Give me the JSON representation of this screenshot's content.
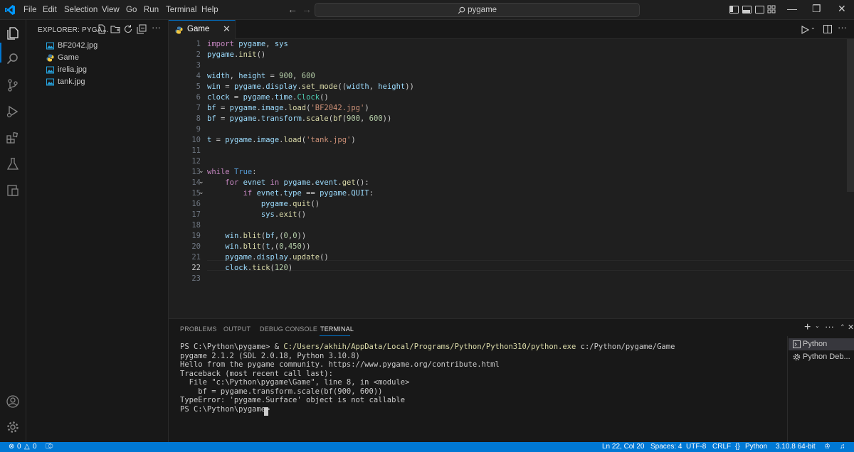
{
  "titlebar": {
    "menus": [
      "File",
      "Edit",
      "Selection",
      "View",
      "Go",
      "Run",
      "Terminal",
      "Help"
    ],
    "search": "pygame"
  },
  "sidebar": {
    "title": "EXPLORER: PYGA...",
    "files": [
      {
        "name": "BF2042.jpg",
        "icon": "image-file-icon"
      },
      {
        "name": "Game",
        "icon": "python-file-icon"
      },
      {
        "name": "irelia.jpg",
        "icon": "image-file-icon"
      },
      {
        "name": "tank.jpg",
        "icon": "image-file-icon"
      }
    ]
  },
  "editor": {
    "tab": "Game",
    "line_numbers": [
      "1",
      "2",
      "3",
      "4",
      "5",
      "6",
      "7",
      "8",
      "9",
      "10",
      "11",
      "12",
      "13",
      "14",
      "15",
      "16",
      "17",
      "18",
      "19",
      "20",
      "21",
      "22",
      "23"
    ],
    "active_line": "22",
    "lines": [
      "import pygame, sys",
      "pygame.init()",
      "",
      "width, height = 900, 600",
      "win = pygame.display.set_mode((width, height))",
      "clock = pygame.time.Clock()",
      "bf = pygame.image.load('BF2042.jpg')",
      "bf = pygame.transform.scale(bf(900, 600))",
      "",
      "t = pygame.image.load('tank.jpg')",
      "",
      "",
      "while True:",
      "    for evnet in pygame.event.get():",
      "        if evnet.type == pygame.QUIT:",
      "            pygame.quit()",
      "            sys.exit()",
      "",
      "    win.blit(bf,(0,0))",
      "    win.blit(t,(0,450))",
      "    pygame.display.update()",
      "    clock.tick(120)",
      ""
    ]
  },
  "panel": {
    "tabs": [
      "PROBLEMS",
      "OUTPUT",
      "DEBUG CONSOLE",
      "TERMINAL"
    ],
    "active_tab": "TERMINAL",
    "terminal_lines": [
      "PS C:\\Python\\pygame> & C:/Users/akhih/AppData/Local/Programs/Python/Python310/python.exe c:/Python/pygame/Game",
      "pygame 2.1.2 (SDL 2.0.18, Python 3.10.8)",
      "Hello from the pygame community. https://www.pygame.org/contribute.html",
      "Traceback (most recent call last):",
      "  File \"c:\\Python\\pygame\\Game\", line 8, in <module>",
      "    bf = pygame.transform.scale(bf(900, 600))",
      "TypeError: 'pygame.Surface' object is not callable",
      "PS C:\\Python\\pygame> "
    ],
    "terminals": [
      "Python",
      "Python Deb..."
    ]
  },
  "statusbar": {
    "errors": "0",
    "warnings": "0",
    "position": "Ln 22, Col 20",
    "spaces": "Spaces: 4",
    "encoding": "UTF-8",
    "eol": "CRLF",
    "language": "Python",
    "interpreter": "3.10.8 64-bit"
  },
  "colors": {
    "accent": "#0078d4",
    "background": "#1f1f1f"
  }
}
